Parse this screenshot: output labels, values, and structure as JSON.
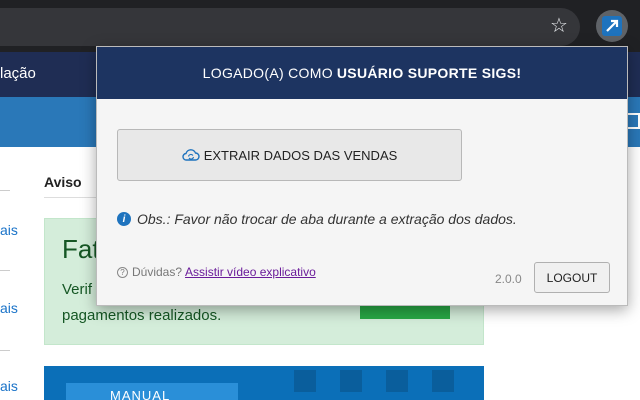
{
  "browser": {
    "star_icon": "star-outline-icon",
    "extension_icon": "edit-arrow-icon"
  },
  "page": {
    "nav_text": "lação",
    "aviso": "Aviso",
    "side_links": [
      "ais",
      "ais",
      "ais"
    ],
    "alert": {
      "title": "Fat",
      "line1": "Verif",
      "line2": "pagamentos realizados."
    },
    "manual": "MANUAL"
  },
  "popup": {
    "header_prefix": "LOGADO(A) COMO",
    "header_user": "USUÁRIO SUPORTE SIGS!",
    "extract_button": "EXTRAIR DADOS DAS VENDAS",
    "obs": "Obs.: Favor não trocar de aba durante a extração dos dados.",
    "help_prefix": "Dúvidas?",
    "help_link": "Assistir vídeo explicativo",
    "version": "2.0.0",
    "logout": "LOGOUT"
  },
  "colors": {
    "header_bg": "#1d3461",
    "accent": "#1e73be",
    "link_visited": "#6a1b9a"
  }
}
